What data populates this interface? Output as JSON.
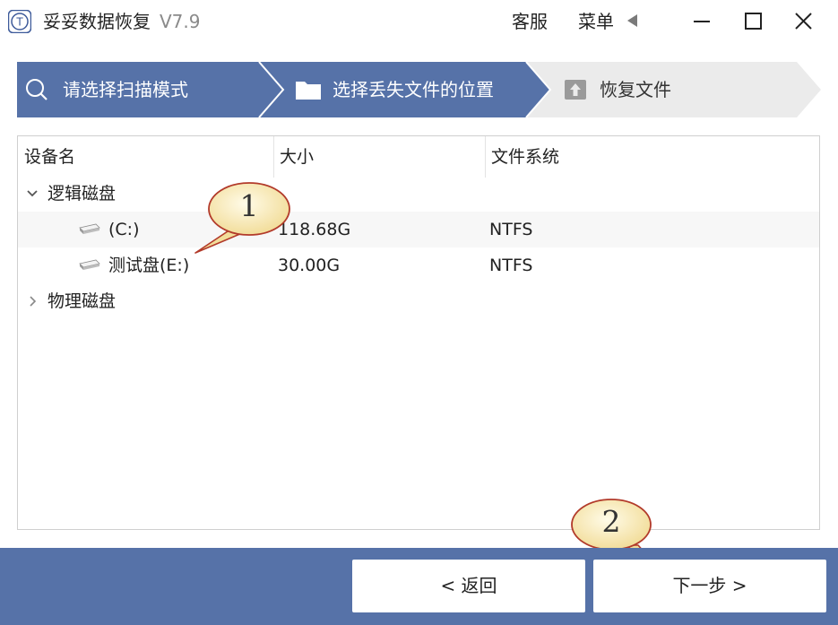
{
  "app": {
    "name": "妥妥数据恢复",
    "version": "V7.9",
    "logo_text": "T"
  },
  "titlebar": {
    "service_label": "客服",
    "menu_label": "菜单"
  },
  "colors": {
    "accent": "#5672a8",
    "step_active": "#5672a8",
    "step_inactive": "#ebebeb",
    "step3_text": "#333333"
  },
  "steps": [
    {
      "label": "请选择扫描模式",
      "icon": "search-icon"
    },
    {
      "label": "选择丢失文件的位置",
      "icon": "folder-icon"
    },
    {
      "label": "恢复文件",
      "icon": "upload-icon"
    }
  ],
  "table": {
    "columns": [
      "设备名",
      "大小",
      "文件系统"
    ],
    "groups": [
      {
        "label": "逻辑磁盘",
        "expanded": true,
        "items": [
          {
            "name": "(C:)",
            "size": "118.68G",
            "fs": "NTFS"
          },
          {
            "name": "测试盘(E:)",
            "size": "30.00G",
            "fs": "NTFS"
          }
        ]
      },
      {
        "label": "物理磁盘",
        "expanded": false,
        "items": []
      }
    ]
  },
  "callouts": [
    "1",
    "2"
  ],
  "buttons": {
    "back": "< 返回",
    "next": "下一步 >"
  }
}
